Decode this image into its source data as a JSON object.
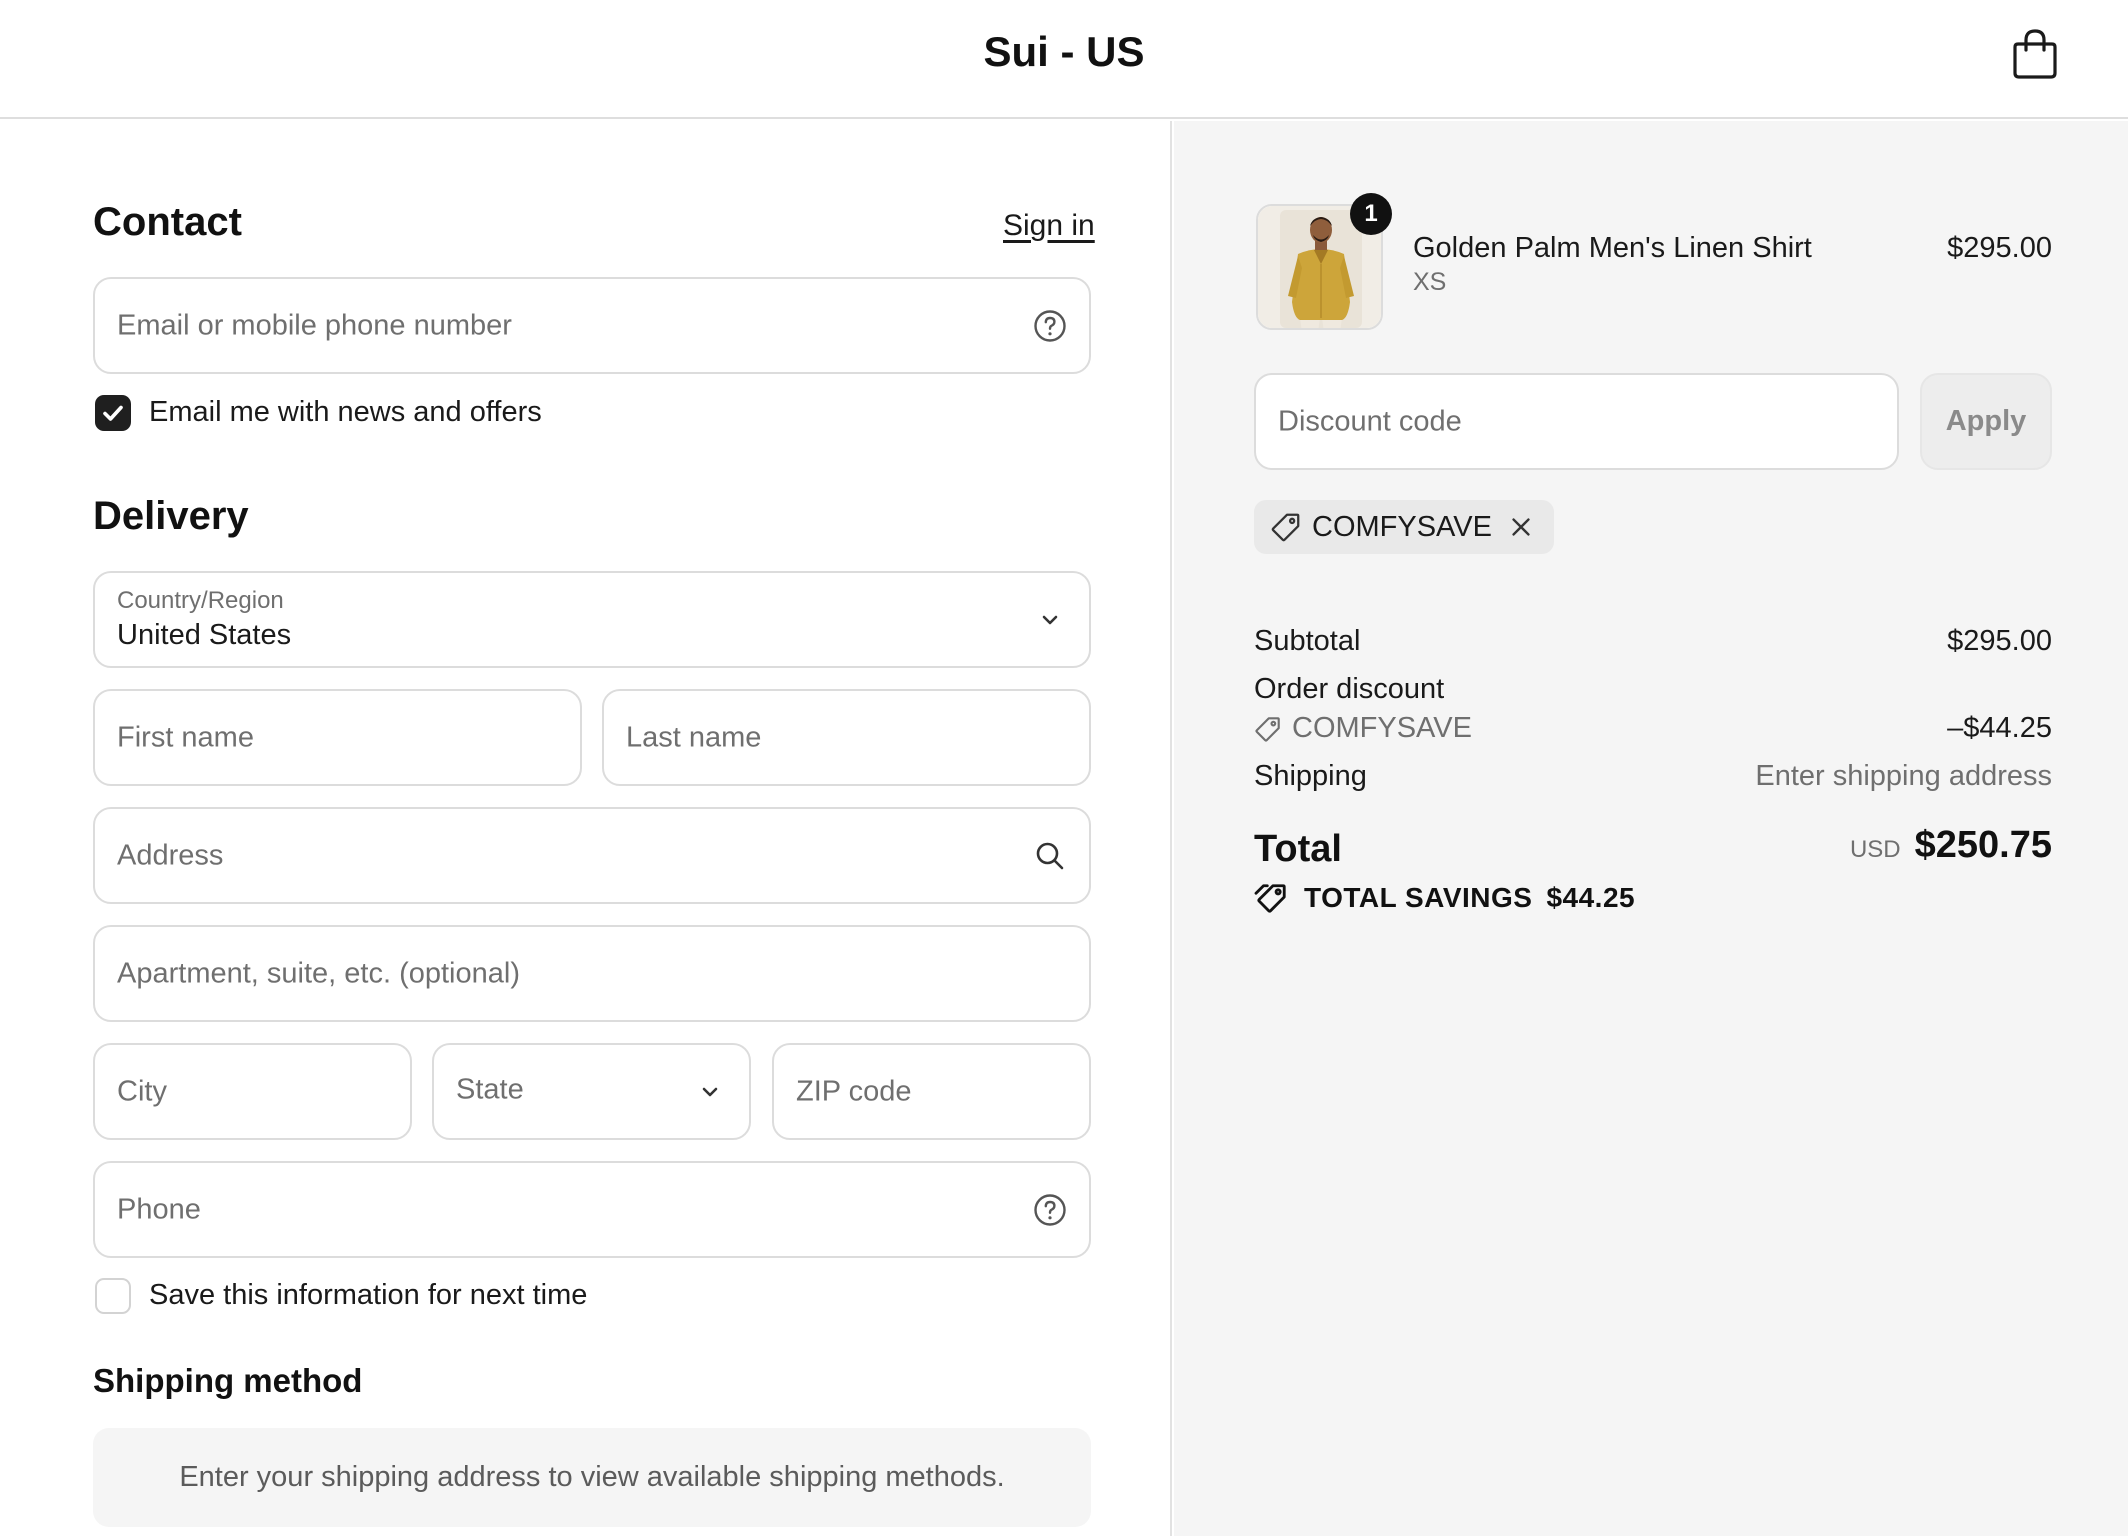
{
  "header": {
    "store_title": "Sui - US",
    "cart_icon": "shopping-bag-icon"
  },
  "contact": {
    "title": "Contact",
    "sign_in_label": "Sign in",
    "email_placeholder": "Email or mobile phone number",
    "newsletter_label": "Email me with news and offers",
    "newsletter_checked": true
  },
  "delivery": {
    "title": "Delivery",
    "country_label": "Country/Region",
    "country_value": "United States",
    "first_name_placeholder": "First name",
    "last_name_placeholder": "Last name",
    "address_placeholder": "Address",
    "apartment_placeholder": "Apartment, suite, etc. (optional)",
    "city_placeholder": "City",
    "state_placeholder": "State",
    "zip_placeholder": "ZIP code",
    "phone_placeholder": "Phone",
    "save_info_label": "Save this information for next time",
    "save_info_checked": false
  },
  "shipping_method": {
    "title": "Shipping method",
    "notice": "Enter your shipping address to view available shipping methods."
  },
  "summary": {
    "product": {
      "name": "Golden Palm Men's Linen Shirt",
      "variant": "XS",
      "price": "$295.00",
      "quantity": "1"
    },
    "discount_placeholder": "Discount code",
    "apply_label": "Apply",
    "applied_code": "COMFYSAVE",
    "subtotal_label": "Subtotal",
    "subtotal_value": "$295.00",
    "order_discount_label": "Order discount",
    "order_discount_code": "COMFYSAVE",
    "order_discount_value": "–$44.25",
    "shipping_label": "Shipping",
    "shipping_value": "Enter shipping address",
    "total_label": "Total",
    "currency": "USD",
    "total_value": "$250.75",
    "savings_label": "TOTAL SAVINGS",
    "savings_value": "$44.25"
  },
  "colors": {
    "text": "#1a1a1a",
    "muted": "#6f6f6f",
    "border": "#dcdcdc",
    "summary_bg": "#f5f5f5",
    "checkbox_on": "#1f1f1f"
  }
}
